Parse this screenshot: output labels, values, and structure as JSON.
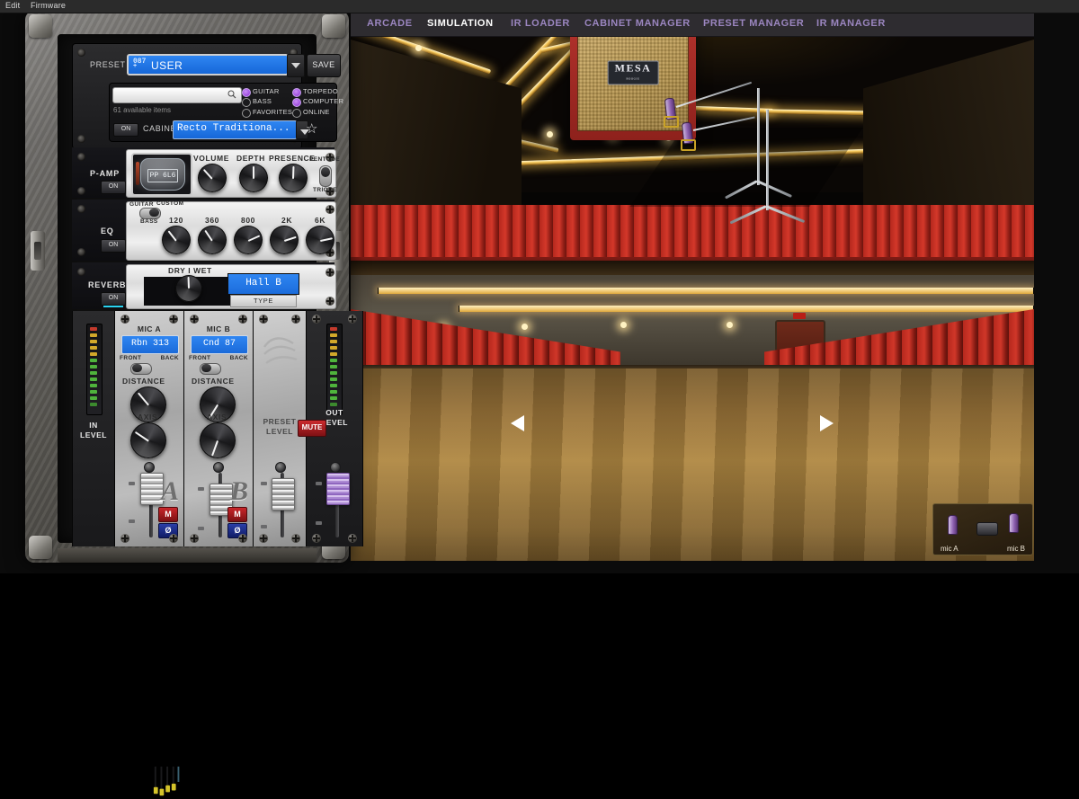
{
  "menubar": {
    "items": [
      {
        "label": "Edit"
      },
      {
        "label": "Firmware"
      }
    ]
  },
  "topnav": {
    "items": [
      {
        "label": "ARCADE",
        "active": false
      },
      {
        "label": "SIMULATION",
        "active": true
      },
      {
        "label": "IR LOADER",
        "active": false
      },
      {
        "label": "CABINET MANAGER",
        "active": false
      },
      {
        "label": "PRESET MANAGER",
        "active": false
      },
      {
        "label": "IR MANAGER",
        "active": false
      }
    ],
    "active_color": "#ffffff",
    "inactive_color": "#9b86c0"
  },
  "preset": {
    "label": "PRESET",
    "number": "087",
    "marker": "+",
    "name": "USER",
    "save_label": "SAVE"
  },
  "browser": {
    "search_value": "",
    "search_placeholder": "",
    "available_items": "61 available items",
    "filters": [
      {
        "label": "GUITAR",
        "selected": true
      },
      {
        "label": "BASS",
        "selected": false
      },
      {
        "label": "FAVORITES",
        "selected": false
      },
      {
        "label": "TORPEDO",
        "selected": true
      },
      {
        "label": "COMPUTER",
        "selected": true
      },
      {
        "label": "ONLINE",
        "selected": false
      }
    ],
    "cabinet_on": "ON",
    "cabinet_label": "CABINET",
    "cabinet_value": "Recto Traditiona..."
  },
  "pamp": {
    "name": "P-AMP",
    "on": "ON",
    "tube": "PP 6L6",
    "knobs": [
      {
        "label": "VOLUME",
        "angle": -42
      },
      {
        "label": "DEPTH",
        "angle": 0
      },
      {
        "label": "PRESENCE",
        "angle": 2
      }
    ],
    "mode_top": "PENTODE",
    "mode_bottom": "TRIODE",
    "mode_selected": "PENTODE"
  },
  "eq": {
    "name": "EQ",
    "on": "ON",
    "switch": {
      "left": "GUITAR",
      "right": "CUSTOM",
      "bottom": "BASS",
      "selected": "CUSTOM"
    },
    "bands": [
      {
        "label": "120",
        "angle": -38
      },
      {
        "label": "360",
        "angle": -34
      },
      {
        "label": "800",
        "angle": 66
      },
      {
        "label": "2K",
        "angle": 72
      },
      {
        "label": "6K",
        "angle": 78
      }
    ]
  },
  "reverb": {
    "name": "REVERB",
    "on": "ON",
    "mix_label": "DRY I WET",
    "mix_angle": -2,
    "value": "Hall B",
    "type_label": "TYPE"
  },
  "mixer": {
    "in_level": {
      "title": "IN\nLEVEL",
      "line1": "IN",
      "line2": "LEVEL"
    },
    "out_level": {
      "line1": "OUT",
      "line2": "LEVEL",
      "mute": "MUTE"
    },
    "preset_level": {
      "line1": "PRESET",
      "line2": "LEVEL"
    },
    "channels": [
      {
        "title": "MIC A",
        "mic": "Rbn 313",
        "letter": "A",
        "pos_left": "FRONT",
        "pos_right": "BACK",
        "pos_selected": "FRONT",
        "distance_label": "DISTANCE",
        "distance_angle": -40,
        "axis_label": "AXIS",
        "axis_angle": -56,
        "mute": "M",
        "phase": "Ø"
      },
      {
        "title": "MIC B",
        "mic": "Cnd 87",
        "letter": "B",
        "pos_left": "FRONT",
        "pos_right": "BACK",
        "pos_selected": "FRONT",
        "distance_label": "DISTANCE",
        "distance_angle": -148,
        "axis_label": "AXIS",
        "axis_angle": -160,
        "mute": "M",
        "phase": "Ø"
      }
    ]
  },
  "scene": {
    "cabinet_brand": "MESA",
    "cabinet_brand_sub": "BOOGIE",
    "arrow_left": "◀",
    "arrow_right": "▶",
    "mic_widget": {
      "mic_a": "mic A",
      "mic_b": "mic B"
    }
  },
  "colors": {
    "accent_blue": "#2f86f2",
    "accent_purple": "#8b2fd4",
    "nav_inactive": "#9b86c0",
    "mute_red": "#cc2a2e",
    "led_cyan": "#2ad2f0"
  }
}
